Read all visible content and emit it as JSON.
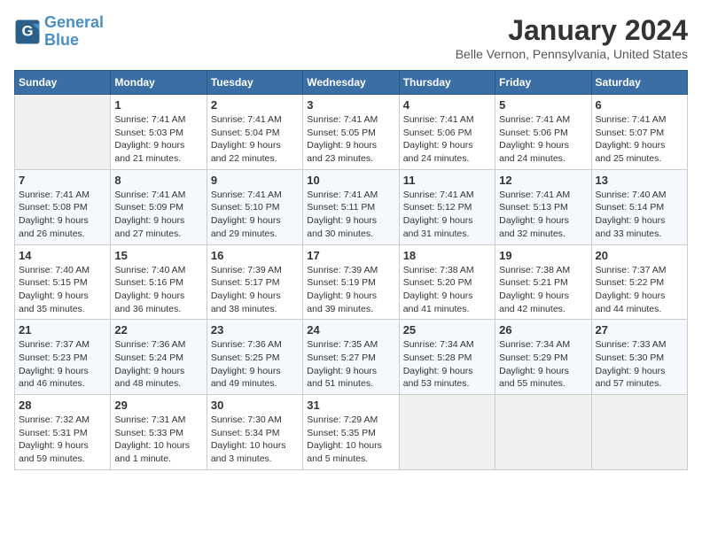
{
  "header": {
    "logo_line1": "General",
    "logo_line2": "Blue",
    "title": "January 2024",
    "subtitle": "Belle Vernon, Pennsylvania, United States"
  },
  "days_of_week": [
    "Sunday",
    "Monday",
    "Tuesday",
    "Wednesday",
    "Thursday",
    "Friday",
    "Saturday"
  ],
  "weeks": [
    [
      {
        "day": "",
        "info": ""
      },
      {
        "day": "1",
        "info": "Sunrise: 7:41 AM\nSunset: 5:03 PM\nDaylight: 9 hours\nand 21 minutes."
      },
      {
        "day": "2",
        "info": "Sunrise: 7:41 AM\nSunset: 5:04 PM\nDaylight: 9 hours\nand 22 minutes."
      },
      {
        "day": "3",
        "info": "Sunrise: 7:41 AM\nSunset: 5:05 PM\nDaylight: 9 hours\nand 23 minutes."
      },
      {
        "day": "4",
        "info": "Sunrise: 7:41 AM\nSunset: 5:06 PM\nDaylight: 9 hours\nand 24 minutes."
      },
      {
        "day": "5",
        "info": "Sunrise: 7:41 AM\nSunset: 5:06 PM\nDaylight: 9 hours\nand 24 minutes."
      },
      {
        "day": "6",
        "info": "Sunrise: 7:41 AM\nSunset: 5:07 PM\nDaylight: 9 hours\nand 25 minutes."
      }
    ],
    [
      {
        "day": "7",
        "info": "Sunrise: 7:41 AM\nSunset: 5:08 PM\nDaylight: 9 hours\nand 26 minutes."
      },
      {
        "day": "8",
        "info": "Sunrise: 7:41 AM\nSunset: 5:09 PM\nDaylight: 9 hours\nand 27 minutes."
      },
      {
        "day": "9",
        "info": "Sunrise: 7:41 AM\nSunset: 5:10 PM\nDaylight: 9 hours\nand 29 minutes."
      },
      {
        "day": "10",
        "info": "Sunrise: 7:41 AM\nSunset: 5:11 PM\nDaylight: 9 hours\nand 30 minutes."
      },
      {
        "day": "11",
        "info": "Sunrise: 7:41 AM\nSunset: 5:12 PM\nDaylight: 9 hours\nand 31 minutes."
      },
      {
        "day": "12",
        "info": "Sunrise: 7:41 AM\nSunset: 5:13 PM\nDaylight: 9 hours\nand 32 minutes."
      },
      {
        "day": "13",
        "info": "Sunrise: 7:40 AM\nSunset: 5:14 PM\nDaylight: 9 hours\nand 33 minutes."
      }
    ],
    [
      {
        "day": "14",
        "info": "Sunrise: 7:40 AM\nSunset: 5:15 PM\nDaylight: 9 hours\nand 35 minutes."
      },
      {
        "day": "15",
        "info": "Sunrise: 7:40 AM\nSunset: 5:16 PM\nDaylight: 9 hours\nand 36 minutes."
      },
      {
        "day": "16",
        "info": "Sunrise: 7:39 AM\nSunset: 5:17 PM\nDaylight: 9 hours\nand 38 minutes."
      },
      {
        "day": "17",
        "info": "Sunrise: 7:39 AM\nSunset: 5:19 PM\nDaylight: 9 hours\nand 39 minutes."
      },
      {
        "day": "18",
        "info": "Sunrise: 7:38 AM\nSunset: 5:20 PM\nDaylight: 9 hours\nand 41 minutes."
      },
      {
        "day": "19",
        "info": "Sunrise: 7:38 AM\nSunset: 5:21 PM\nDaylight: 9 hours\nand 42 minutes."
      },
      {
        "day": "20",
        "info": "Sunrise: 7:37 AM\nSunset: 5:22 PM\nDaylight: 9 hours\nand 44 minutes."
      }
    ],
    [
      {
        "day": "21",
        "info": "Sunrise: 7:37 AM\nSunset: 5:23 PM\nDaylight: 9 hours\nand 46 minutes."
      },
      {
        "day": "22",
        "info": "Sunrise: 7:36 AM\nSunset: 5:24 PM\nDaylight: 9 hours\nand 48 minutes."
      },
      {
        "day": "23",
        "info": "Sunrise: 7:36 AM\nSunset: 5:25 PM\nDaylight: 9 hours\nand 49 minutes."
      },
      {
        "day": "24",
        "info": "Sunrise: 7:35 AM\nSunset: 5:27 PM\nDaylight: 9 hours\nand 51 minutes."
      },
      {
        "day": "25",
        "info": "Sunrise: 7:34 AM\nSunset: 5:28 PM\nDaylight: 9 hours\nand 53 minutes."
      },
      {
        "day": "26",
        "info": "Sunrise: 7:34 AM\nSunset: 5:29 PM\nDaylight: 9 hours\nand 55 minutes."
      },
      {
        "day": "27",
        "info": "Sunrise: 7:33 AM\nSunset: 5:30 PM\nDaylight: 9 hours\nand 57 minutes."
      }
    ],
    [
      {
        "day": "28",
        "info": "Sunrise: 7:32 AM\nSunset: 5:31 PM\nDaylight: 9 hours\nand 59 minutes."
      },
      {
        "day": "29",
        "info": "Sunrise: 7:31 AM\nSunset: 5:33 PM\nDaylight: 10 hours\nand 1 minute."
      },
      {
        "day": "30",
        "info": "Sunrise: 7:30 AM\nSunset: 5:34 PM\nDaylight: 10 hours\nand 3 minutes."
      },
      {
        "day": "31",
        "info": "Sunrise: 7:29 AM\nSunset: 5:35 PM\nDaylight: 10 hours\nand 5 minutes."
      },
      {
        "day": "",
        "info": ""
      },
      {
        "day": "",
        "info": ""
      },
      {
        "day": "",
        "info": ""
      }
    ]
  ]
}
